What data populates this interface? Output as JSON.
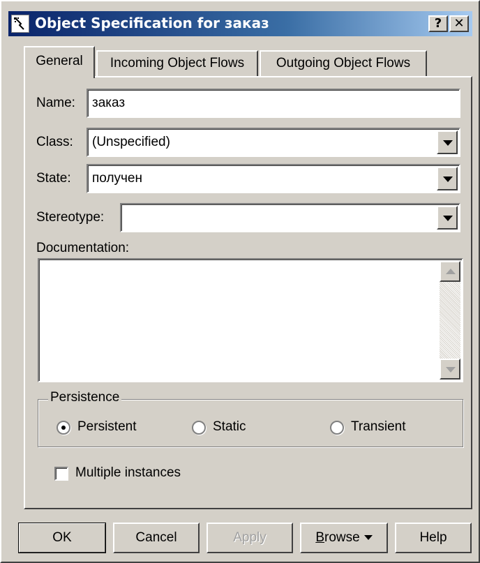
{
  "window": {
    "title": "Object Specification for заказ",
    "help_btn": "?",
    "close_btn": "✕",
    "icon": "object-spec-icon"
  },
  "tabs": [
    {
      "label": "General",
      "active": true
    },
    {
      "label": "Incoming Object Flows",
      "active": false
    },
    {
      "label": "Outgoing Object Flows",
      "active": false
    }
  ],
  "general": {
    "name_label": "Name:",
    "name_value": "заказ",
    "class_label": "Class:",
    "class_value": "(Unspecified)",
    "state_label": "State:",
    "state_value": "получен",
    "stereotype_label": "Stereotype:",
    "stereotype_value": "",
    "documentation_label": "Documentation:",
    "documentation_value": ""
  },
  "persistence": {
    "title": "Persistence",
    "options": [
      {
        "label": "Persistent",
        "selected": true
      },
      {
        "label": "Static",
        "selected": false
      },
      {
        "label": "Transient",
        "selected": false
      }
    ]
  },
  "multiple_instances": {
    "label": "Multiple instances",
    "checked": false
  },
  "buttons": {
    "ok": "OK",
    "cancel": "Cancel",
    "apply": "Apply",
    "browse_accel": "B",
    "browse_rest": "rowse",
    "help": "Help"
  },
  "colors": {
    "titlebar_start": "#0a246a",
    "titlebar_end": "#a6caf0",
    "face": "#d4d0c8"
  }
}
